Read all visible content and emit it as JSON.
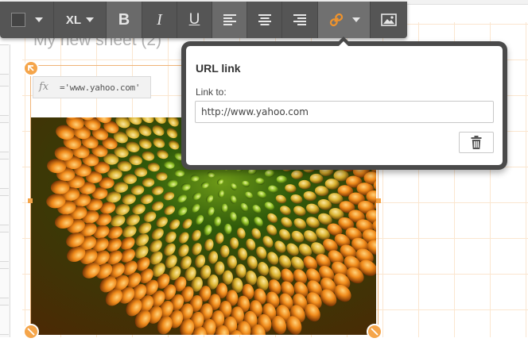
{
  "sheet": {
    "title": "My new sheet (2)"
  },
  "toolbar": {
    "size_label": "XL",
    "bold_label": "B",
    "italic_label": "I",
    "underline_label": "U"
  },
  "formula": {
    "fx_label": "fx",
    "expression": "='www.yahoo.com'"
  },
  "url_popover": {
    "title": "URL link",
    "link_label": "Link to:",
    "link_value": "http://www.yahoo.com"
  },
  "icons": {
    "color": "color-swatch-icon",
    "align_left": "align-left-icon",
    "align_center": "align-center-icon",
    "align_right": "align-right-icon",
    "link": "link-icon",
    "image": "image-icon",
    "delete": "trash-icon"
  },
  "colors": {
    "accent": "#f5a54a",
    "toolbar_bg": "#555555",
    "link_icon": "#f0932b"
  }
}
